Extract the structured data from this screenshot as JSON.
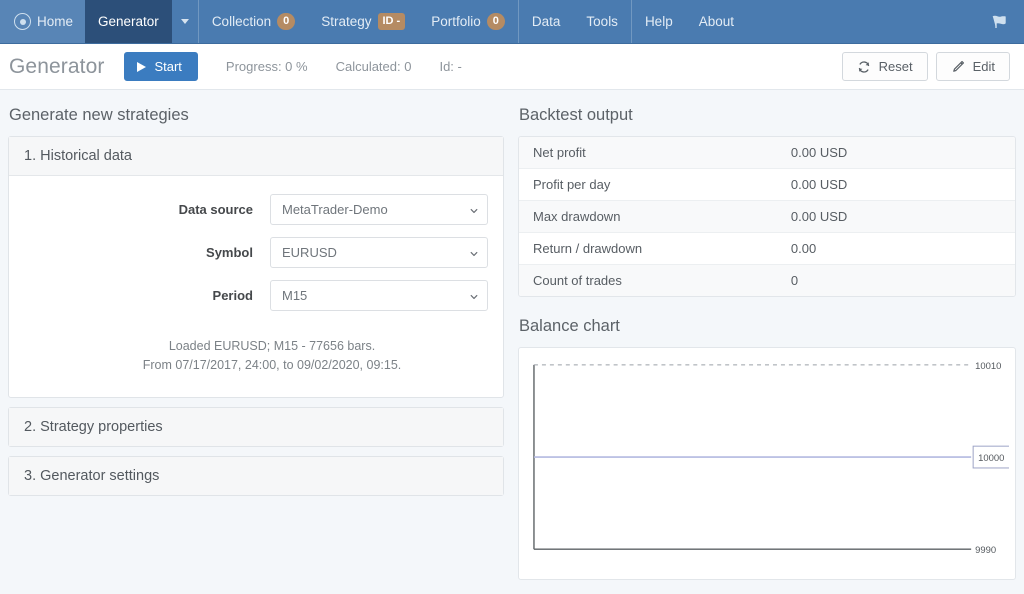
{
  "navbar": {
    "brand_icon": "circle-dot-logo-icon",
    "items": [
      {
        "label": "Home",
        "name": "nav-item-home",
        "active": false
      },
      {
        "label": "Generator",
        "name": "nav-item-generator",
        "active": true
      },
      {
        "label": "Collection",
        "name": "nav-item-collection",
        "badge": "0"
      },
      {
        "label": "Strategy",
        "name": "nav-item-strategy",
        "badge": "ID -"
      },
      {
        "label": "Portfolio",
        "name": "nav-item-portfolio",
        "badge": "0"
      },
      {
        "label": "Data",
        "name": "nav-item-data"
      },
      {
        "label": "Tools",
        "name": "nav-item-tools"
      },
      {
        "label": "Help",
        "name": "nav-item-help"
      },
      {
        "label": "About",
        "name": "nav-item-about"
      }
    ],
    "dropdown_caret": "chevron-down-icon",
    "right_icon": "flag-icon"
  },
  "toolbar": {
    "title": "Generator",
    "start_label": "Start",
    "progress": "Progress: 0 %",
    "calculated": "Calculated: 0",
    "id": "Id: -",
    "reset_label": "Reset",
    "edit_label": "Edit",
    "reset_icon": "refresh-icon",
    "edit_icon": "pencil-icon"
  },
  "left": {
    "heading": "Generate new strategies",
    "panels": [
      {
        "title": "1. Historical data",
        "expanded": true
      },
      {
        "title": "2. Strategy properties",
        "expanded": false
      },
      {
        "title": "3. Generator settings",
        "expanded": false
      }
    ],
    "form": {
      "data_source": {
        "label": "Data source",
        "value": "MetaTrader-Demo",
        "options": [
          "MetaTrader-Demo"
        ]
      },
      "symbol": {
        "label": "Symbol",
        "value": "EURUSD",
        "options": [
          "EURUSD"
        ]
      },
      "period": {
        "label": "Period",
        "value": "M15",
        "options": [
          "M15"
        ]
      }
    },
    "loaded_line1": "Loaded EURUSD; M15 - 77656 bars.",
    "loaded_line2": "From 07/17/2017, 24:00, to 09/02/2020, 09:15."
  },
  "right": {
    "backtest_heading": "Backtest output",
    "results": [
      {
        "label": "Net profit",
        "value": "0.00 USD"
      },
      {
        "label": "Profit per day",
        "value": "0.00 USD"
      },
      {
        "label": "Max drawdown",
        "value": "0.00 USD"
      },
      {
        "label": "Return / drawdown",
        "value": "0.00"
      },
      {
        "label": "Count of trades",
        "value": "0"
      }
    ],
    "chart_heading": "Balance chart"
  },
  "chart_data": {
    "type": "line",
    "title": "Balance chart",
    "xlabel": "",
    "ylabel": "",
    "ylim": [
      9990,
      10010
    ],
    "yticks": [
      9990,
      10000,
      10010
    ],
    "ytick_labels": [
      "9990",
      "10000",
      "10010"
    ],
    "grid": true,
    "legend": "none",
    "series": [
      {
        "name": "Balance",
        "color": "#b3b9e0",
        "x": [
          0,
          1
        ],
        "values": [
          10000,
          10000
        ]
      }
    ],
    "highlight_label": "10000",
    "annotations": [
      {
        "text": "10010",
        "y": 10010,
        "style": "dashed-gridline"
      },
      {
        "text": "10000",
        "y": 10000,
        "style": "boxed-value-label"
      },
      {
        "text": "9990",
        "y": 9990,
        "style": "axis-baseline"
      }
    ]
  },
  "colors": {
    "navbar": "#4a7bb0",
    "navbar_active": "#2c4f79",
    "accent": "#3b7cc0",
    "badge": "#b58b63",
    "page_bg": "#f4f7fa",
    "chart_line": "#b3b9e0"
  }
}
